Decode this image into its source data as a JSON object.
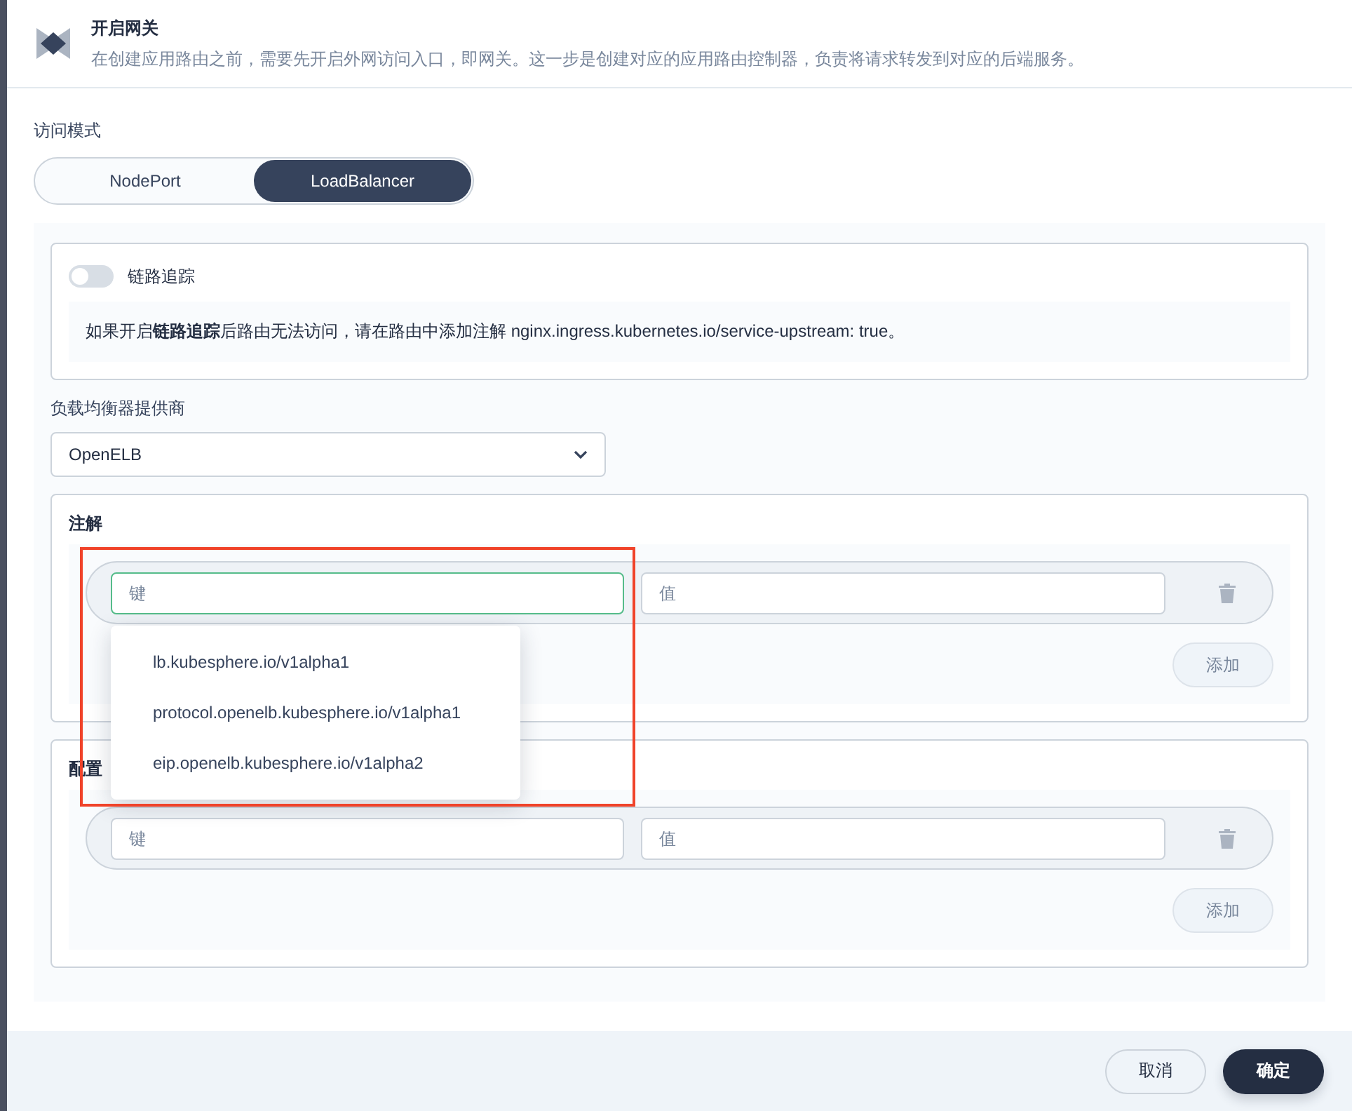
{
  "dialog": {
    "title": "开启网关",
    "description": "在创建应用路由之前，需要先开启外网访问入口，即网关。这一步是创建对应的应用路由控制器，负责将请求转发到对应的后端服务。"
  },
  "access_mode": {
    "label": "访问模式",
    "options": [
      {
        "label": "NodePort",
        "selected": false
      },
      {
        "label": "LoadBalancer",
        "selected": true
      }
    ]
  },
  "tracing": {
    "label": "链路追踪",
    "on": false,
    "note": "如果开启**链路追踪**后路由无法访问，请在路由中添加注解 nginx.ingress.kubernetes.io/service-upstream: true。"
  },
  "provider": {
    "label": "负载均衡器提供商",
    "value": "OpenELB"
  },
  "sections": [
    {
      "title": "注解",
      "rows": [
        {
          "key": {
            "placeholder": "键",
            "focused": true
          },
          "value": {
            "placeholder": "值"
          }
        }
      ],
      "add_label": "添加"
    },
    {
      "title": "配置",
      "rows": [
        {
          "key": {
            "placeholder": "键",
            "focused": false
          },
          "value": {
            "placeholder": "值"
          }
        }
      ],
      "add_label": "添加"
    }
  ],
  "dropdown": {
    "items": [
      "lb.kubesphere.io/v1alpha1",
      "protocol.openelb.kubesphere.io/v1alpha1",
      "eip.openelb.kubesphere.io/v1alpha2"
    ]
  },
  "footer": {
    "buttons": [
      {
        "label": "取消",
        "kind": "secondary"
      },
      {
        "label": "确定",
        "kind": "primary"
      }
    ]
  }
}
